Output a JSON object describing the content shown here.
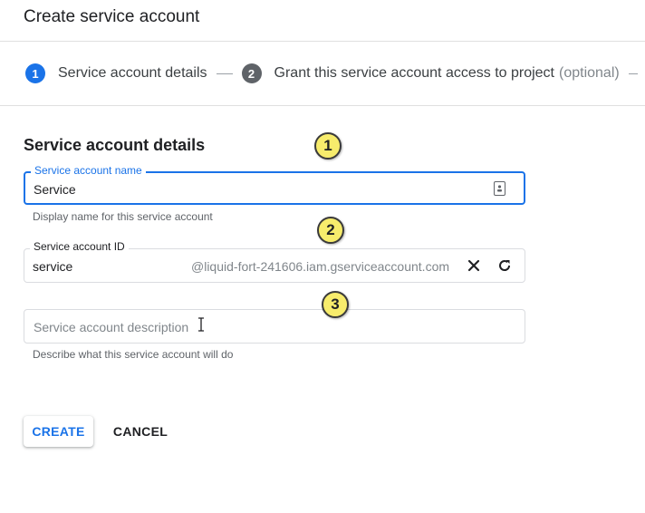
{
  "page": {
    "title": "Create service account"
  },
  "stepper": {
    "steps": [
      {
        "number": "1",
        "label": "Service account details",
        "optional": ""
      },
      {
        "number": "2",
        "label": "Grant this service account access to project",
        "optional": "(optional)"
      }
    ]
  },
  "form": {
    "heading": "Service account details",
    "name_field": {
      "label": "Service account name",
      "value": "Service",
      "hint": "Display name for this service account",
      "icon": "contact-card-icon"
    },
    "id_field": {
      "label": "Service account ID",
      "value": "service",
      "suffix": "@liquid-fort-241606.iam.gserviceaccount.com"
    },
    "description_field": {
      "placeholder": "Service account description",
      "hint": "Describe what this service account will do"
    }
  },
  "annotations": [
    "1",
    "2",
    "3"
  ],
  "buttons": {
    "create": "CREATE",
    "cancel": "CANCEL"
  },
  "colors": {
    "accent": "#1a73e8",
    "badge": "#f7ec6c"
  }
}
